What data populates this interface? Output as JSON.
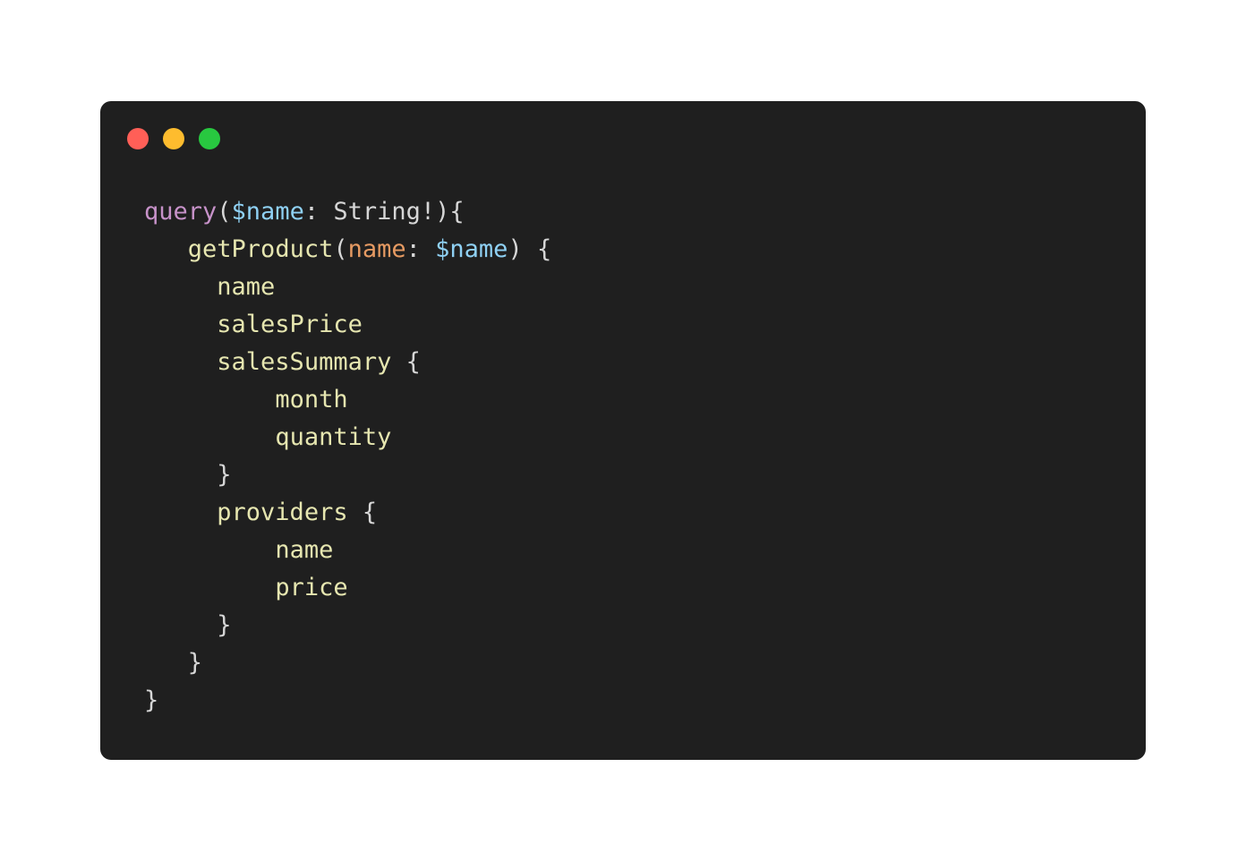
{
  "window": {
    "controls": [
      {
        "name": "close-button",
        "color": "#ff5f57"
      },
      {
        "name": "minimize-button",
        "color": "#febc2e"
      },
      {
        "name": "maximize-button",
        "color": "#28c840"
      }
    ]
  },
  "colors": {
    "background": "#1f1f1f",
    "keyword": "#c792c9",
    "variable": "#8fd1f4",
    "argument": "#e69a62",
    "field": "#e6e6b0",
    "punctuation": "#d6d6d6"
  },
  "code": {
    "lines": [
      {
        "tokens": [
          {
            "text": "query",
            "kind": "keyword"
          },
          {
            "text": "(",
            "kind": "punctuation"
          },
          {
            "text": "$name",
            "kind": "variable"
          },
          {
            "text": ": String!){",
            "kind": "punctuation"
          }
        ]
      },
      {
        "tokens": [
          {
            "text": "   ",
            "kind": "punctuation"
          },
          {
            "text": "getProduct",
            "kind": "field"
          },
          {
            "text": "(",
            "kind": "punctuation"
          },
          {
            "text": "name",
            "kind": "argument"
          },
          {
            "text": ": ",
            "kind": "punctuation"
          },
          {
            "text": "$name",
            "kind": "variable"
          },
          {
            "text": ") {",
            "kind": "punctuation"
          }
        ]
      },
      {
        "tokens": [
          {
            "text": "     ",
            "kind": "punctuation"
          },
          {
            "text": "name",
            "kind": "field"
          }
        ]
      },
      {
        "tokens": [
          {
            "text": "     ",
            "kind": "punctuation"
          },
          {
            "text": "salesPrice",
            "kind": "field"
          }
        ]
      },
      {
        "tokens": [
          {
            "text": "     ",
            "kind": "punctuation"
          },
          {
            "text": "salesSummary",
            "kind": "field"
          },
          {
            "text": " {",
            "kind": "punctuation"
          }
        ]
      },
      {
        "tokens": [
          {
            "text": "         ",
            "kind": "punctuation"
          },
          {
            "text": "month",
            "kind": "field"
          }
        ]
      },
      {
        "tokens": [
          {
            "text": "         ",
            "kind": "punctuation"
          },
          {
            "text": "quantity",
            "kind": "field"
          }
        ]
      },
      {
        "tokens": [
          {
            "text": "     }",
            "kind": "punctuation"
          }
        ]
      },
      {
        "tokens": [
          {
            "text": "     ",
            "kind": "punctuation"
          },
          {
            "text": "providers",
            "kind": "field"
          },
          {
            "text": " {",
            "kind": "punctuation"
          }
        ]
      },
      {
        "tokens": [
          {
            "text": "         ",
            "kind": "punctuation"
          },
          {
            "text": "name",
            "kind": "field"
          }
        ]
      },
      {
        "tokens": [
          {
            "text": "         ",
            "kind": "punctuation"
          },
          {
            "text": "price",
            "kind": "field"
          }
        ]
      },
      {
        "tokens": [
          {
            "text": "     }",
            "kind": "punctuation"
          }
        ]
      },
      {
        "tokens": [
          {
            "text": "   }",
            "kind": "punctuation"
          }
        ]
      },
      {
        "tokens": [
          {
            "text": "}",
            "kind": "punctuation"
          }
        ]
      }
    ]
  }
}
